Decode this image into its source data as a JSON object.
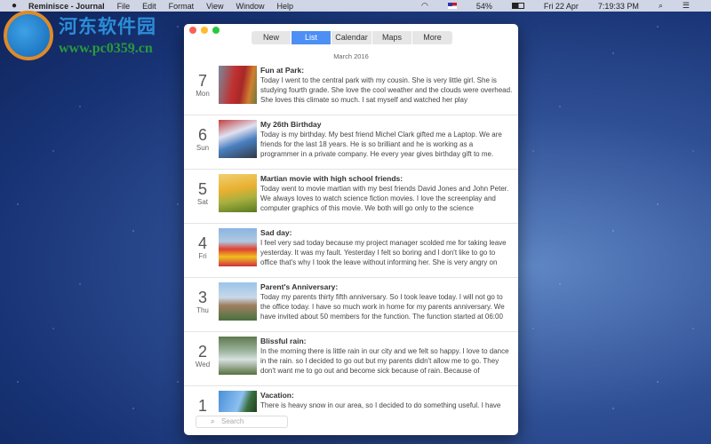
{
  "menubar": {
    "apple": "",
    "app": "Reminisce - Journal",
    "items": [
      "File",
      "Edit",
      "Format",
      "View",
      "Window",
      "Help"
    ],
    "battery": "54%",
    "date": "Fri 22 Apr",
    "time": "7:19:33 PM"
  },
  "watermark": {
    "cn": "河东软件园",
    "url": "www.pc0359.cn"
  },
  "toolbar": {
    "tabs": [
      "New",
      "List",
      "Calendar",
      "Maps",
      "More"
    ],
    "active": "List"
  },
  "month": "March 2016",
  "entries": [
    {
      "day": "7",
      "weekday": "Mon",
      "title": "Fun at Park:",
      "body": "Today I went to the central park with my cousin. She is very little girl. She is studying fourth grade. She love the cool weather and the clouds were overhead. She loves this climate so much. I sat myself and watched her play",
      "thumb": "linear-gradient(100deg,#7a8a9a 0%,#c03030 40%,#a82828 60%,#d08030 80%,#6a7a40 100%)"
    },
    {
      "day": "6",
      "weekday": "Sun",
      "title": "My 26th Birthday",
      "body": "Today is my birthday. My best friend Michel Clark gifted me a Laptop. We are friends for the last 18 years. He is so brilliant and he is working as a programmer in a private company. He every year gives birthday gift to me.",
      "thumb": "linear-gradient(160deg,#c04040 0%,#e0e0f0 35%,#4a80c0 60%,#303848 100%)"
    },
    {
      "day": "5",
      "weekday": "Sat",
      "title": "Martian movie with high school friends:",
      "body": "Today went to movie martian with my best friends David Jones and John Peter. We always loves to watch science fiction movies. I love the screenplay and computer graphics of this movie. We both will go only to the science",
      "thumb": "linear-gradient(170deg,#f0d070 0%,#e8b030 40%,#a8b040 65%,#587a20 100%)"
    },
    {
      "day": "4",
      "weekday": "Fri",
      "title": "Sad day:",
      "body": "I feel very sad today because my project manager scolded me for taking leave yesterday. It was my fault. Yesterday I felt so boring and I don't like to go to office that's why I took the leave without informing her. She is very angry on",
      "thumb": "linear-gradient(180deg,#8ab4e0 0%,#b0c8e0 35%,#e04030 55%,#f0c020 75%,#d03040 100%)"
    },
    {
      "day": "3",
      "weekday": "Thu",
      "title": "Parent's Anniversary:",
      "body": "Today my parents thirty fifth anniversary. So I took leave today. I will not go to the office today. I have so much work in home for my parents anniversary. We have invited about 50 members for the function. The function started at 06:00",
      "thumb": "linear-gradient(180deg,#9cc4e8 0%,#c8d8e8 40%,#a08060 60%,#4a7040 100%)"
    },
    {
      "day": "2",
      "weekday": "Wed",
      "title": "Blissful rain:",
      "body": "In the morning there is little rain in our city and we felt so happy. I love to dance in the rain. so I decided to go out but my parents didn't allow me to go. They don't want me to go out and become sick because of rain. Because of",
      "thumb": "linear-gradient(180deg,#607850 0%,#a0b8a0 40%,#d8e0e0 60%,#587040 100%)"
    },
    {
      "day": "1",
      "weekday": "",
      "title": "Vacation:",
      "body": "There is heavy snow in our area, so I decided to do something useful. I have",
      "thumb": "linear-gradient(110deg,#4a90d8 0%,#8cc0f0 55%,#3a7040 75%,#204020 100%)"
    }
  ],
  "search": {
    "placeholder": "Search"
  }
}
